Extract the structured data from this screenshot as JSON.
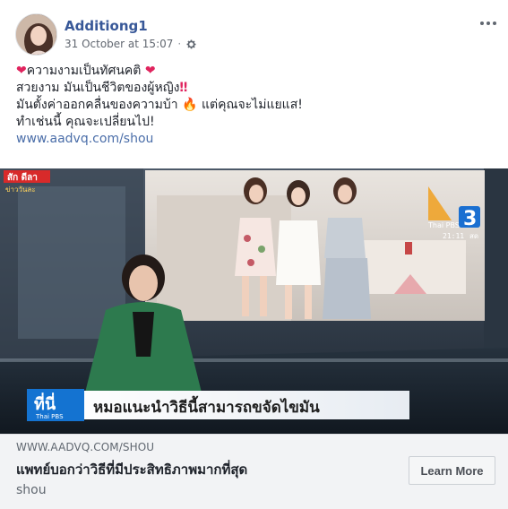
{
  "post": {
    "author": "Additiong1",
    "timestamp": "31 October at 15:07",
    "privacy_icon": "gear-icon",
    "more_icon": "more-options-icon"
  },
  "message": {
    "line1": "ความงามเป็นทัศนคติ",
    "line2": "สวยงาม มันเป็นชีวิตของผู้หญิง",
    "line3a": "มันตั้งค่าออกคลื่นของความบ้า",
    "line3b": "แต่คุณจะไม่แยแส!",
    "line4": "ทำเช่นนี้ คุณจะเปลี่ยนไป!",
    "link": "www.aadvq.com/shou"
  },
  "media": {
    "corner_tag_1": "สัก ดีลา",
    "corner_tag_2": "ข่าววันละ",
    "channel": "Thai PBS",
    "channel_number": "3",
    "channel_suffix": "สด",
    "clock": "21:11",
    "lower_third_tag": "ที่นี่",
    "lower_third_sub": "Thai PBS",
    "headline": "หมอแนะนำวิธีนี้สามารถขจัดไขมัน"
  },
  "preview": {
    "domain": "WWW.AADVQ.COM/SHOU",
    "title": "แพทย์บอกว่าวิธีที่มีประสิทธิภาพมากที่สุด",
    "description": "shou",
    "cta": "Learn More"
  },
  "colors": {
    "author_link": "#385898",
    "preview_bg": "#f2f3f5",
    "heart": "#e0245e"
  }
}
